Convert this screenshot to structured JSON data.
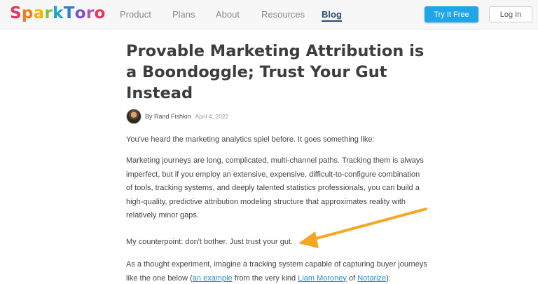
{
  "header": {
    "logo": {
      "letters": [
        "S",
        "p",
        "a",
        "r",
        "k",
        "T",
        "o",
        "r",
        "o"
      ],
      "letter_colors": [
        "#e4355b",
        "#f47a20",
        "#f7b500",
        "#7cbf3a",
        "#1aa6c9",
        "#2c7fd6",
        "#7a4fd0",
        "#c14fa9",
        "#e4355b"
      ]
    },
    "nav": [
      "Product",
      "Plans",
      "About",
      "Resources",
      "Blog"
    ],
    "active_nav": "Blog",
    "try_button": "Try It Free",
    "login_button": "Log In",
    "accent_color": "#20a6e8"
  },
  "article": {
    "title": "Provable Marketing Attribution is a Boondoggle; Trust Your Gut Instead",
    "author": "By Rand Fishkin",
    "date": "April 4, 2022",
    "paragraphs": {
      "p1": "You've heard the marketing analytics spiel before. It goes something like:",
      "p2": "Marketing journeys are long, complicated, multi-channel paths. Tracking them is always imperfect, but if you employ an extensive, expensive, difficult-to-configure combination of tools, tracking systems, and deeply talented statistics professionals, you can build a high-quality, predictive attribution modeling structure that approximates reality with relatively minor gaps.",
      "p3": "My counterpoint: don't bother. Just trust your gut.",
      "p4": {
        "prefix": "As a thought experiment, imagine a tracking system capable of capturing buyer journeys like the one below (",
        "link1": "an example",
        "mid": " from the very kind ",
        "link2": "Liam Moroney",
        "of": " of ",
        "link3": "Notarize",
        "suffix": "):"
      }
    }
  },
  "annotation": {
    "arrow_color": "#f5a623",
    "points_to": "p3"
  }
}
